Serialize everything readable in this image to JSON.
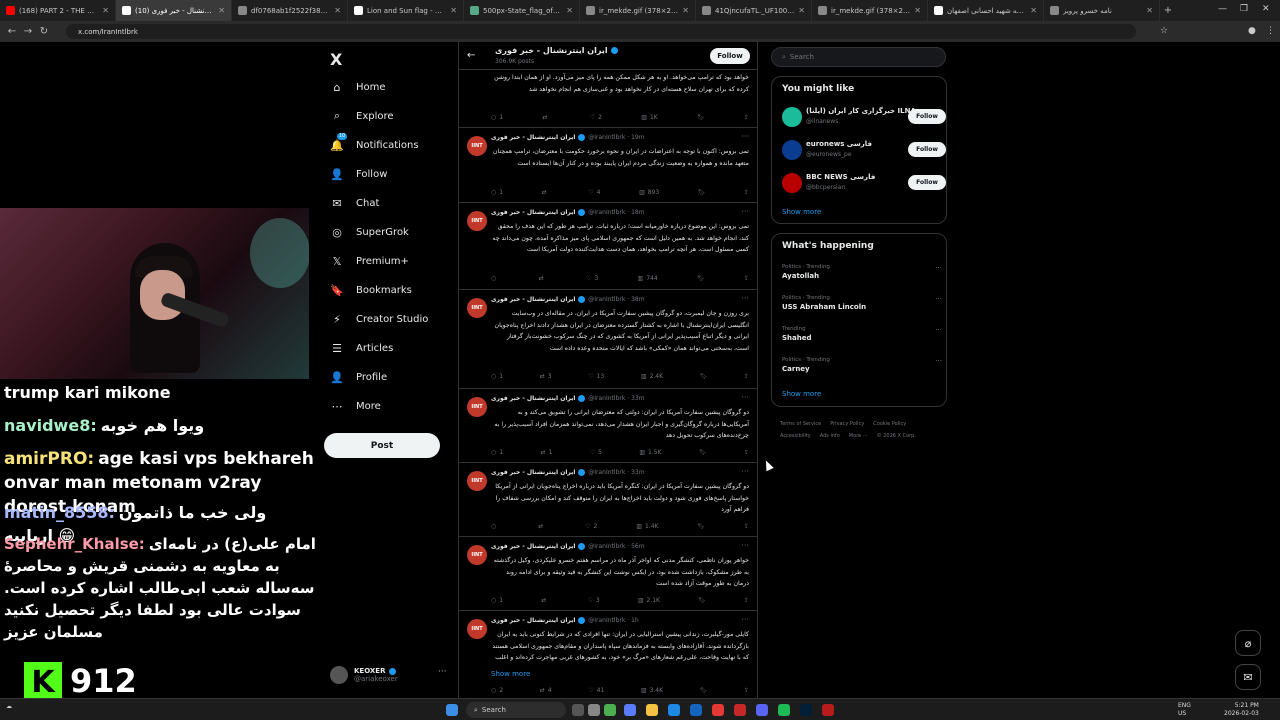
{
  "browser": {
    "tabs": [
      {
        "title": "(168) PART 2 - THE UNSEEN ...",
        "color": "#ff0000",
        "active": false
      },
      {
        "title": "ایران اینترنشنال - خبر فوری (10)",
        "color": "#ffffff",
        "active": true
      },
      {
        "title": "df0768ab1f2522f382bc8613...",
        "color": "#888888",
        "active": false
      },
      {
        "title": "Lion and Sun flag - Wikipedia",
        "color": "#ffffff",
        "active": false
      },
      {
        "title": "500px-State_flag_of_Iran_(19...",
        "color": "#5a8",
        "active": false
      },
      {
        "title": "ir_mekde.gif (378×216)",
        "color": "#888888",
        "active": false
      },
      {
        "title": "41QjncufaTL._UF1000,1000...",
        "color": "#888888",
        "active": false
      },
      {
        "title": "ir_mekde.gif (378×216)",
        "color": "#888888",
        "active": false
      },
      {
        "title": "مدرسه شهید احسانی اصفهان",
        "color": "#ffffff",
        "active": false
      },
      {
        "title": "نامه خسرو پرویز",
        "color": "#888888",
        "active": false
      }
    ],
    "url": "x.com/IranIntlbrk"
  },
  "stream": {
    "chat": [
      {
        "user": "",
        "message": "trump kari mikone",
        "color": "#ffffff"
      },
      {
        "user": "navidwe8:",
        "message": "ویوا هم خوبه",
        "color": "#a8f0c8"
      },
      {
        "user": "amirPRO:",
        "message": "age kasi vps bekhareh onvar man metonam v2ray dorost konam",
        "color": "#f5e27a"
      },
      {
        "user": "matin_8558:",
        "message": "ولی خب ما ذاتمون اریاییه 😁",
        "color": "#a9b8ff"
      },
      {
        "user": "Sephehr_Khalse:",
        "message": "امام علی(ع) در نامه‌ای به معاویه به دشمنی قریش و محاصرهٔ سه‌ساله شعب ابی‌طالب اشاره کرده است. سوادت عالی بود لطفا دیگر تحصیل نکنید مسلمان عزیز",
        "color": "#ff9aa8"
      }
    ],
    "viewers": "912"
  },
  "nav": {
    "logo": "X",
    "items": [
      {
        "label": "Home",
        "icon": "⌂"
      },
      {
        "label": "Explore",
        "icon": "⌕"
      },
      {
        "label": "Notifications",
        "icon": "🔔"
      },
      {
        "label": "Follow",
        "icon": "👤"
      },
      {
        "label": "Chat",
        "icon": "✉"
      },
      {
        "label": "SuperGrok",
        "icon": "◎"
      },
      {
        "label": "Premium+",
        "icon": "𝕏"
      },
      {
        "label": "Bookmarks",
        "icon": "🔖"
      },
      {
        "label": "Creator Studio",
        "icon": "⚡"
      },
      {
        "label": "Articles",
        "icon": "☰"
      },
      {
        "label": "Profile",
        "icon": "👤"
      },
      {
        "label": "More",
        "icon": "⋯"
      }
    ],
    "notif_badge": "10",
    "post": "Post",
    "account": {
      "name": "KEOXER",
      "handle": "@ariakeoxer"
    }
  },
  "timeline": {
    "title": "ایران اینترنشنال - خبر فوری",
    "count": "306.9K posts",
    "follow": "Follow",
    "author": "ایران اینترنشنال - خبر فوری",
    "handle": "@IranIntlbrk",
    "tweets": [
      {
        "time": "",
        "text": "خواهد بود که ترامپ می‌خواهد. او به هر شکل ممکن همه را پای میز می‌آورد. او از همان ابتدا روشن کرده که برای تهران سلاح هسته‌ای در کار نخواهد بود و غنی‌سازی هم انجام نخواهد شد",
        "reply": "1",
        "retweet": "",
        "like": "2",
        "views": "1K"
      },
      {
        "time": "19m",
        "text": "تمی بروس: اکنون با توجه به اعتراضات در ایران و نحوه برخورد حکومت با معترضان، ترامپ همچنان متعهد مانده و همواره به وضعیت زندگی مردم ایران پایبند بوده و در کنار آن‌ها ایستاده است",
        "reply": "1",
        "retweet": "",
        "like": "4",
        "views": "893"
      },
      {
        "time": "18m",
        "text": "تمی بروس: این موضوع درباره خاورمیانه است؛ درباره ثبات. ترامپ هر طور که این هدف را محقق کند، انجام خواهد شد. به همین دلیل است که جمهوری اسلامی پای میز مذاکره آمده، چون می‌داند چه کسی مسئول است. هر آنچه ترامپ بخواهد، همان دست هدایت‌کننده دولت آمریکا است",
        "reply": "",
        "retweet": "",
        "like": "3",
        "views": "744"
      },
      {
        "time": "38m",
        "text": "بری روزن و جان لیمبرت، دو گروگان پیشین سفارت آمریکا در ایران، در مقاله‌ای در وب‌سایت انگلیسی ایران‌اینترنشنال با اشاره به کشتار گسترده معترضان در ایران هشدار دادند اخراج پناه‌جویان ایرانی و دیگر اتباع آسیب‌پذیر ایرانی از آمریکا به کشوری که در چنگ سرکوب خشونت‌بار گرفتار است، به‌سختی می‌تواند همان «کمکی» باشد که ایالات متحده وعده داده است",
        "reply": "1",
        "retweet": "3",
        "like": "13",
        "views": "2.4K"
      },
      {
        "time": "33m",
        "text": "دو گروگان پیشین سفارت آمریکا در ایران: دولتی که معترضان ایرانی را تشویق می‌کند و به آمریکایی‌ها درباره گروگان‌گیری و اجبار ایران هشدار می‌دهد، نمی‌تواند همزمان افراد آسیب‌پذیر را به چرخ‌دنده‌های سرکوب تحویل دهد",
        "reply": "1",
        "retweet": "1",
        "like": "5",
        "views": "1.5K"
      },
      {
        "time": "33m",
        "text": "دو گروگان پیشین سفارت آمریکا در ایران: کنگره آمریکا باید درباره اخراج پناه‌جویان ایرانی از آمریکا خواستار پاسخ‌های فوری شود و دولت باید اخراج‌ها به ایران را متوقف کند و امکان بررسی شفاف را فراهم آورد",
        "reply": "",
        "retweet": "",
        "like": "2",
        "views": "1.4K"
      },
      {
        "time": "56m",
        "text": "خواهر پوران ناظمی، کنشگر مدنی که اواخر آذر ماه در مراسم هفتم خسرو علیکردی، وکیل درگذشته به طرز مشکوک، بازداشت شده بود، در ایکس نوشت این کنشگر به قید وثیقه و برای ادامه روند درمان به طور موقت آزاد شده است",
        "reply": "1",
        "retweet": "",
        "like": "3",
        "views": "2.1K"
      },
      {
        "time": "1h",
        "text": "کایلی مور-گیلبرت، زندانی پیشین استرالیایی در ایران: تنها افرادی که در شرایط کنونی باید به ایران بازگردانده شوند، آقازاده‌های وابسته به فرماندهان سپاه پاسداران و مقام‌های جمهوری اسلامی هستند که با نهایت وقاحت، علی‌رغم شعارهای «مرگ بر» خود، به کشورهای غربی مهاجرت کرده‌اند و اغلب",
        "reply": "2",
        "retweet": "4",
        "like": "41",
        "views": "3.4K"
      }
    ],
    "show_more": "Show more"
  },
  "right": {
    "search_placeholder": "Search",
    "might_like": "You might like",
    "suggestions": [
      {
        "name": "خبرگزاری کار ایران (ایلنا) ILNA",
        "handle": "@ilnanews",
        "color": "#1abc9c"
      },
      {
        "name": "euronews فارسی",
        "handle": "@euronews_pe",
        "color": "#0a3d91"
      },
      {
        "name": "BBC NEWS فارسی",
        "handle": "@bbcpersian",
        "color": "#b80000"
      }
    ],
    "follow": "Follow",
    "show_more": "Show more",
    "happening": "What's happening",
    "trends": [
      {
        "context": "Politics · Trending",
        "title": "Ayatollah"
      },
      {
        "context": "Politics · Trending",
        "title": "USS Abraham Lincoln"
      },
      {
        "context": "Trending",
        "title": "Shahed"
      },
      {
        "context": "Politics · Trending",
        "title": "Carney"
      }
    ],
    "footer": [
      "Terms of Service",
      "Privacy Policy",
      "Cookie Policy",
      "Accessibility",
      "Ads info",
      "More ···",
      "© 2026 X Corp."
    ]
  },
  "taskbar": {
    "search": "Search",
    "lang": "ENG\nUS",
    "time": "5:21 PM",
    "date": "2026-02-03"
  }
}
